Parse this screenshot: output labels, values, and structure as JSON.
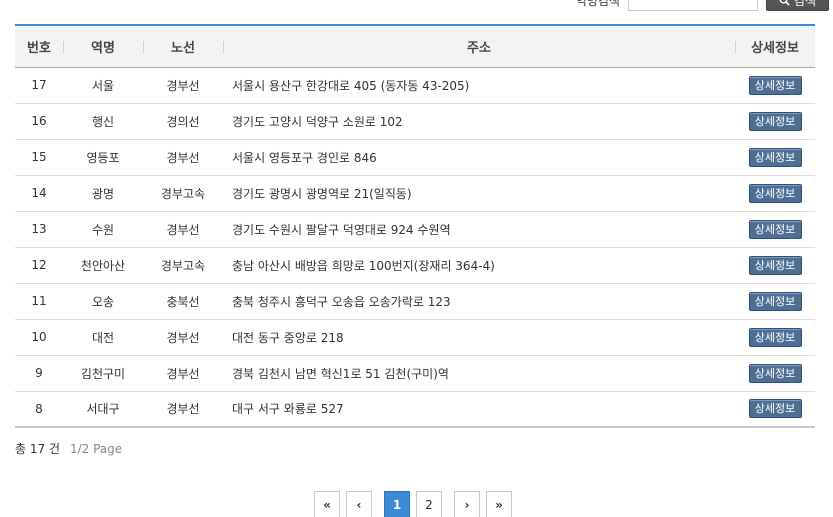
{
  "search": {
    "label": "역명검색",
    "value": "",
    "placeholder": "",
    "button_label": "검색"
  },
  "table": {
    "columns": [
      "번호",
      "역명",
      "노선",
      "주소",
      "상세정보"
    ],
    "detail_label": "상세정보",
    "rows": [
      {
        "no": "17",
        "station": "서울",
        "line": "경부선",
        "address": "서울시 용산구 한강대로 405 (동자동 43-205)"
      },
      {
        "no": "16",
        "station": "행신",
        "line": "경의선",
        "address": "경기도 고양시 덕양구 소원로 102"
      },
      {
        "no": "15",
        "station": "영등포",
        "line": "경부선",
        "address": "서울시 영등포구 경인로 846"
      },
      {
        "no": "14",
        "station": "광명",
        "line": "경부고속",
        "address": "경기도 광명시 광명역로 21(일직동)"
      },
      {
        "no": "13",
        "station": "수원",
        "line": "경부선",
        "address": "경기도 수원시 팔달구 덕영대로 924 수원역"
      },
      {
        "no": "12",
        "station": "천안아산",
        "line": "경부고속",
        "address": "충남 아산시 배방읍 희망로 100번지(장재리 364-4)"
      },
      {
        "no": "11",
        "station": "오송",
        "line": "충북선",
        "address": "충북 청주시 흥덕구 오송읍 오송가락로 123"
      },
      {
        "no": "10",
        "station": "대전",
        "line": "경부선",
        "address": "대전 동구 중앙로 218"
      },
      {
        "no": "9",
        "station": "김천구미",
        "line": "경부선",
        "address": "경북 김천시 남면 혁신1로 51 김천(구미)역"
      },
      {
        "no": "8",
        "station": "서대구",
        "line": "경부선",
        "address": "대구 서구 와룡로 527"
      }
    ]
  },
  "summary": {
    "total": "총 17 건",
    "page_info": "1/2 Page"
  },
  "pagination": {
    "first": "«",
    "prev": "‹",
    "pages": [
      "1",
      "2"
    ],
    "active_page": "1",
    "next": "›",
    "last": "»"
  }
}
